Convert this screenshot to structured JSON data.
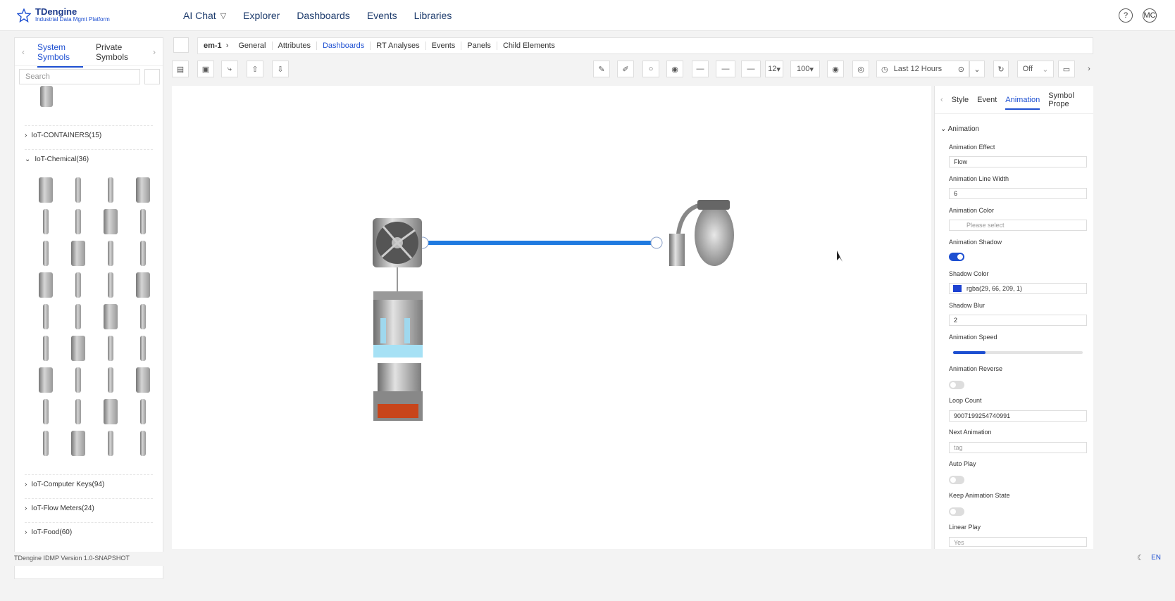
{
  "brand": {
    "title": "TDengine",
    "subtitle": "Industrial Data Mgmt Platform"
  },
  "nav": {
    "items": [
      "AI Chat",
      "Explorer",
      "Dashboards",
      "Events",
      "Libraries"
    ]
  },
  "user": {
    "help": "?",
    "initials": "MC"
  },
  "left": {
    "tabs": [
      "System Symbols",
      "Private Symbols"
    ],
    "search_placeholder": "Search",
    "groups": [
      "IoT-CONTAINERS(15)",
      "IoT-Chemical(36)",
      "IoT-Computer Keys(94)",
      "IoT-Flow Meters(24)",
      "IoT-Food(60)"
    ]
  },
  "breadcrumb": {
    "root": "em-1",
    "items": [
      "General",
      "Attributes",
      "Dashboards",
      "RT Analyses",
      "Events",
      "Panels",
      "Child Elements"
    ],
    "active": "Dashboards"
  },
  "toolbar": {
    "font_size": "12",
    "zoom": "100",
    "time_range": "Last 12 Hours",
    "refresh": "Off"
  },
  "right": {
    "tabs": [
      "Style",
      "Event",
      "Animation",
      "Symbol Prope"
    ],
    "active_tab": "Animation",
    "section": "Animation",
    "fields": {
      "effect_label": "Animation Effect",
      "effect_value": "Flow",
      "line_width_label": "Animation Line Width",
      "line_width_value": "6",
      "color_label": "Animation Color",
      "color_placeholder": "Please select",
      "shadow_label": "Animation Shadow",
      "shadow_color_label": "Shadow Color",
      "shadow_color_value": "rgba(29, 66, 209, 1)",
      "shadow_blur_label": "Shadow Blur",
      "shadow_blur_value": "2",
      "speed_label": "Animation Speed",
      "reverse_label": "Animation Reverse",
      "loop_label": "Loop Count",
      "loop_value": "9007199254740991",
      "next_label": "Next Animation",
      "next_placeholder": "tag",
      "autoplay_label": "Auto Play",
      "keep_label": "Keep Animation State",
      "linear_label": "Linear Play",
      "linear_value": "Yes"
    },
    "speed_fraction": 0.25,
    "accent": "#1d4fd1"
  },
  "footer": {
    "version": "TDengine IDMP Version 1.0-SNAPSHOT",
    "lang": "EN"
  }
}
